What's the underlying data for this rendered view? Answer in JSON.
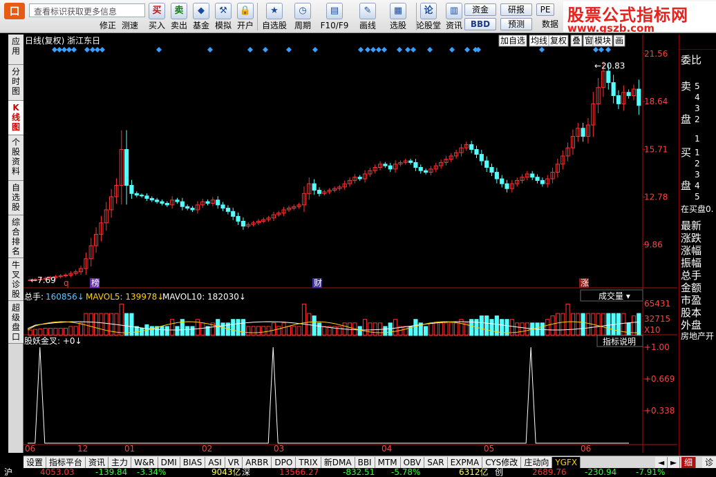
{
  "toolbar": {
    "search_placeholder": "查看标识获取更多信息",
    "buttons": [
      {
        "label": "修正",
        "icon": "edit-icon",
        "glyph": ""
      },
      {
        "label": "测速",
        "icon": "speed-icon",
        "glyph": ""
      },
      {
        "label": "买入",
        "icon": "buy-icon",
        "glyph": "买"
      },
      {
        "label": "卖出",
        "icon": "sell-icon",
        "glyph": "卖"
      },
      {
        "label": "基金",
        "icon": "fund-icon",
        "glyph": "◆"
      },
      {
        "label": "模拟",
        "icon": "hammer-icon",
        "glyph": "⚒"
      },
      {
        "label": "开户",
        "icon": "lock-icon",
        "glyph": "🔒"
      },
      {
        "label": "自选股",
        "icon": "star-icon",
        "glyph": "★"
      },
      {
        "label": "周期",
        "icon": "clock-icon",
        "glyph": "◷"
      },
      {
        "label": "F10/F9",
        "icon": "f10-icon",
        "glyph": "▤"
      },
      {
        "label": "画线",
        "icon": "pencil-icon",
        "glyph": "✎"
      },
      {
        "label": "选股",
        "icon": "filter-icon",
        "glyph": "▦"
      },
      {
        "label": "论股堂",
        "icon": "discuss-icon",
        "glyph": "论"
      },
      {
        "label": "资讯",
        "icon": "news-icon",
        "glyph": "▥"
      }
    ],
    "right_buttons": [
      "资金",
      "研报",
      "BBD",
      "预测",
      "PE",
      "数据"
    ],
    "brand_title": "股票公式指标网",
    "brand_url": "www.gszb.com"
  },
  "left_tabs": [
    "应用",
    "分时图",
    "K线图",
    "个股资料",
    "自选股",
    "综合排名",
    "牛叉诊股",
    "超级盘口"
  ],
  "chart": {
    "header": "日线(复权)  浙江东日",
    "buttons": [
      "加自选",
      "均线",
      "复权",
      "叠",
      "窗",
      "模块",
      "画"
    ],
    "price_axis": [
      "21.56",
      "18.64",
      "15.71",
      "12.78",
      "9.86"
    ],
    "high_label": "20.83",
    "low_label": "7.69",
    "markers": [
      {
        "text": "q",
        "color": "#ff4040"
      },
      {
        "text": "榜",
        "color": "#ffffff"
      },
      {
        "text": "财",
        "color": "#ffffff"
      },
      {
        "text": "涨",
        "color": "#ffffff"
      }
    ],
    "volume": {
      "label": "总手:",
      "value": "160856",
      "ma5_label": "MAVOL5:",
      "ma5": "139978",
      "ma10_label": "MAVOL10:",
      "ma10": "182030",
      "select": "成交量",
      "axis": [
        "65431",
        "32715",
        "X10"
      ]
    },
    "indicator": {
      "label": "股妖金叉:",
      "value": "+0",
      "button": "指标说明",
      "axis": [
        "+1.00",
        "+0.669",
        "+0.338"
      ]
    },
    "x_labels": [
      "06",
      "12",
      "01",
      "02",
      "03",
      "04",
      "05",
      "06"
    ]
  },
  "chart_data": {
    "type": "candlestick",
    "title": "日线(复权) 浙江东日",
    "y_ticks": [
      21.56,
      18.64,
      15.71,
      12.78,
      9.86
    ],
    "high": 20.83,
    "low": 7.69,
    "x_ticks": [
      "06",
      "12",
      "01",
      "02",
      "03",
      "04",
      "05",
      "06"
    ],
    "close_series": [
      7.7,
      7.72,
      7.75,
      7.8,
      7.85,
      7.9,
      7.95,
      8.0,
      8.1,
      8.2,
      8.4,
      9.0,
      9.8,
      10.5,
      11.2,
      12.0,
      12.8,
      13.5,
      15.7,
      13.5,
      13.0,
      12.9,
      12.85,
      12.7,
      12.6,
      12.5,
      12.4,
      12.3,
      12.6,
      12.5,
      12.2,
      12.1,
      12.0,
      12.3,
      12.5,
      12.4,
      12.6,
      12.3,
      12.1,
      11.9,
      11.6,
      11.3,
      11.0,
      11.1,
      11.2,
      11.3,
      11.4,
      11.5,
      11.7,
      11.8,
      12.0,
      12.1,
      12.2,
      12.3,
      13.0,
      13.6,
      13.2,
      13.0,
      13.1,
      13.2,
      13.3,
      13.4,
      13.6,
      13.8,
      14.0,
      13.9,
      14.2,
      14.4,
      14.6,
      14.8,
      14.7,
      14.5,
      14.8,
      14.9,
      15.0,
      14.9,
      14.6,
      14.4,
      14.3,
      14.5,
      14.7,
      14.9,
      15.1,
      15.3,
      15.5,
      15.8,
      16.0,
      15.7,
      15.4,
      15.0,
      14.6,
      14.3,
      13.9,
      13.6,
      13.3,
      13.6,
      13.8,
      14.0,
      14.2,
      14.0,
      13.8,
      13.6,
      13.9,
      14.3,
      14.8,
      15.3,
      15.8,
      16.5,
      17.0,
      16.5,
      17.2,
      18.5,
      19.5,
      20.5,
      19.8,
      19.0,
      18.5,
      19.2,
      19.0,
      19.4,
      18.4
    ],
    "volume_axis": [
      65431,
      32715
    ],
    "volume_unit": "X10",
    "volume_total": 160856,
    "mavol5": 139978,
    "mavol10": 182030,
    "indicator_name": "股妖金叉",
    "indicator_value": 0,
    "indicator_axis": [
      1.0,
      0.669,
      0.338
    ],
    "indicator_spikes_fraction": [
      0.02,
      0.4,
      0.82
    ]
  },
  "right_panel": {
    "rows": [
      {
        "label": "委比",
        "value": ""
      },
      {
        "label": "卖",
        "value": "5"
      },
      {
        "label": "",
        "value": "4"
      },
      {
        "label": "",
        "value": "3"
      },
      {
        "label": "盘",
        "value": "2"
      },
      {
        "label": "",
        "value": "1"
      },
      {
        "label": "买",
        "value": "1"
      },
      {
        "label": "",
        "value": "2"
      },
      {
        "label": "",
        "value": "3"
      },
      {
        "label": "盘",
        "value": "4"
      },
      {
        "label": "",
        "value": "5"
      }
    ],
    "items": [
      "在买盘0.",
      "最新",
      "涨跌",
      "涨幅",
      "振幅",
      "总手",
      "金额",
      "市盈",
      "股本",
      "外盘",
      "房地产开"
    ]
  },
  "bottom_tabs": [
    "设置",
    "指标平台",
    "资讯",
    "主力",
    "W&R",
    "DMI",
    "BIAS",
    "ASI",
    "VR",
    "ARBR",
    "DPO",
    "TRIX",
    "新DMA",
    "BBI",
    "MTM",
    "OBV",
    "SAR",
    "EXPMA",
    "CYS修改",
    "庄动向",
    "YGFX"
  ],
  "bottom_right": [
    "◄",
    "►",
    "细",
    "诊"
  ],
  "statusbar": {
    "items": [
      {
        "text": "沪",
        "color": "#ffffff"
      },
      {
        "text": "4053.03",
        "color": "#ff3030"
      },
      {
        "text": "-139.84",
        "color": "#30ff30"
      },
      {
        "text": "-3.34%",
        "color": "#30ff30"
      },
      {
        "text": "9043亿",
        "color": "#ffff40"
      },
      {
        "text": "深",
        "color": "#ffffff"
      },
      {
        "text": "13566.27",
        "color": "#ff3030"
      },
      {
        "text": "-832.51",
        "color": "#30ff30"
      },
      {
        "text": "-5.78%",
        "color": "#30ff30"
      },
      {
        "text": "6312亿",
        "color": "#ffff40"
      },
      {
        "text": "创",
        "color": "#ffffff"
      },
      {
        "text": "2689.76",
        "color": "#ff3030"
      },
      {
        "text": "-230.94",
        "color": "#30ff30"
      },
      {
        "text": "-7.91%",
        "color": "#30ff30"
      }
    ]
  },
  "colors": {
    "up": "#ff3232",
    "down": "#54ffff",
    "axis": "#b01010",
    "grid_text": "#ff4040",
    "ma_white": "#ffffff",
    "ma_yellow": "#ffd200",
    "diamond": "#3aa0ff",
    "indicator": "#ffffff"
  }
}
